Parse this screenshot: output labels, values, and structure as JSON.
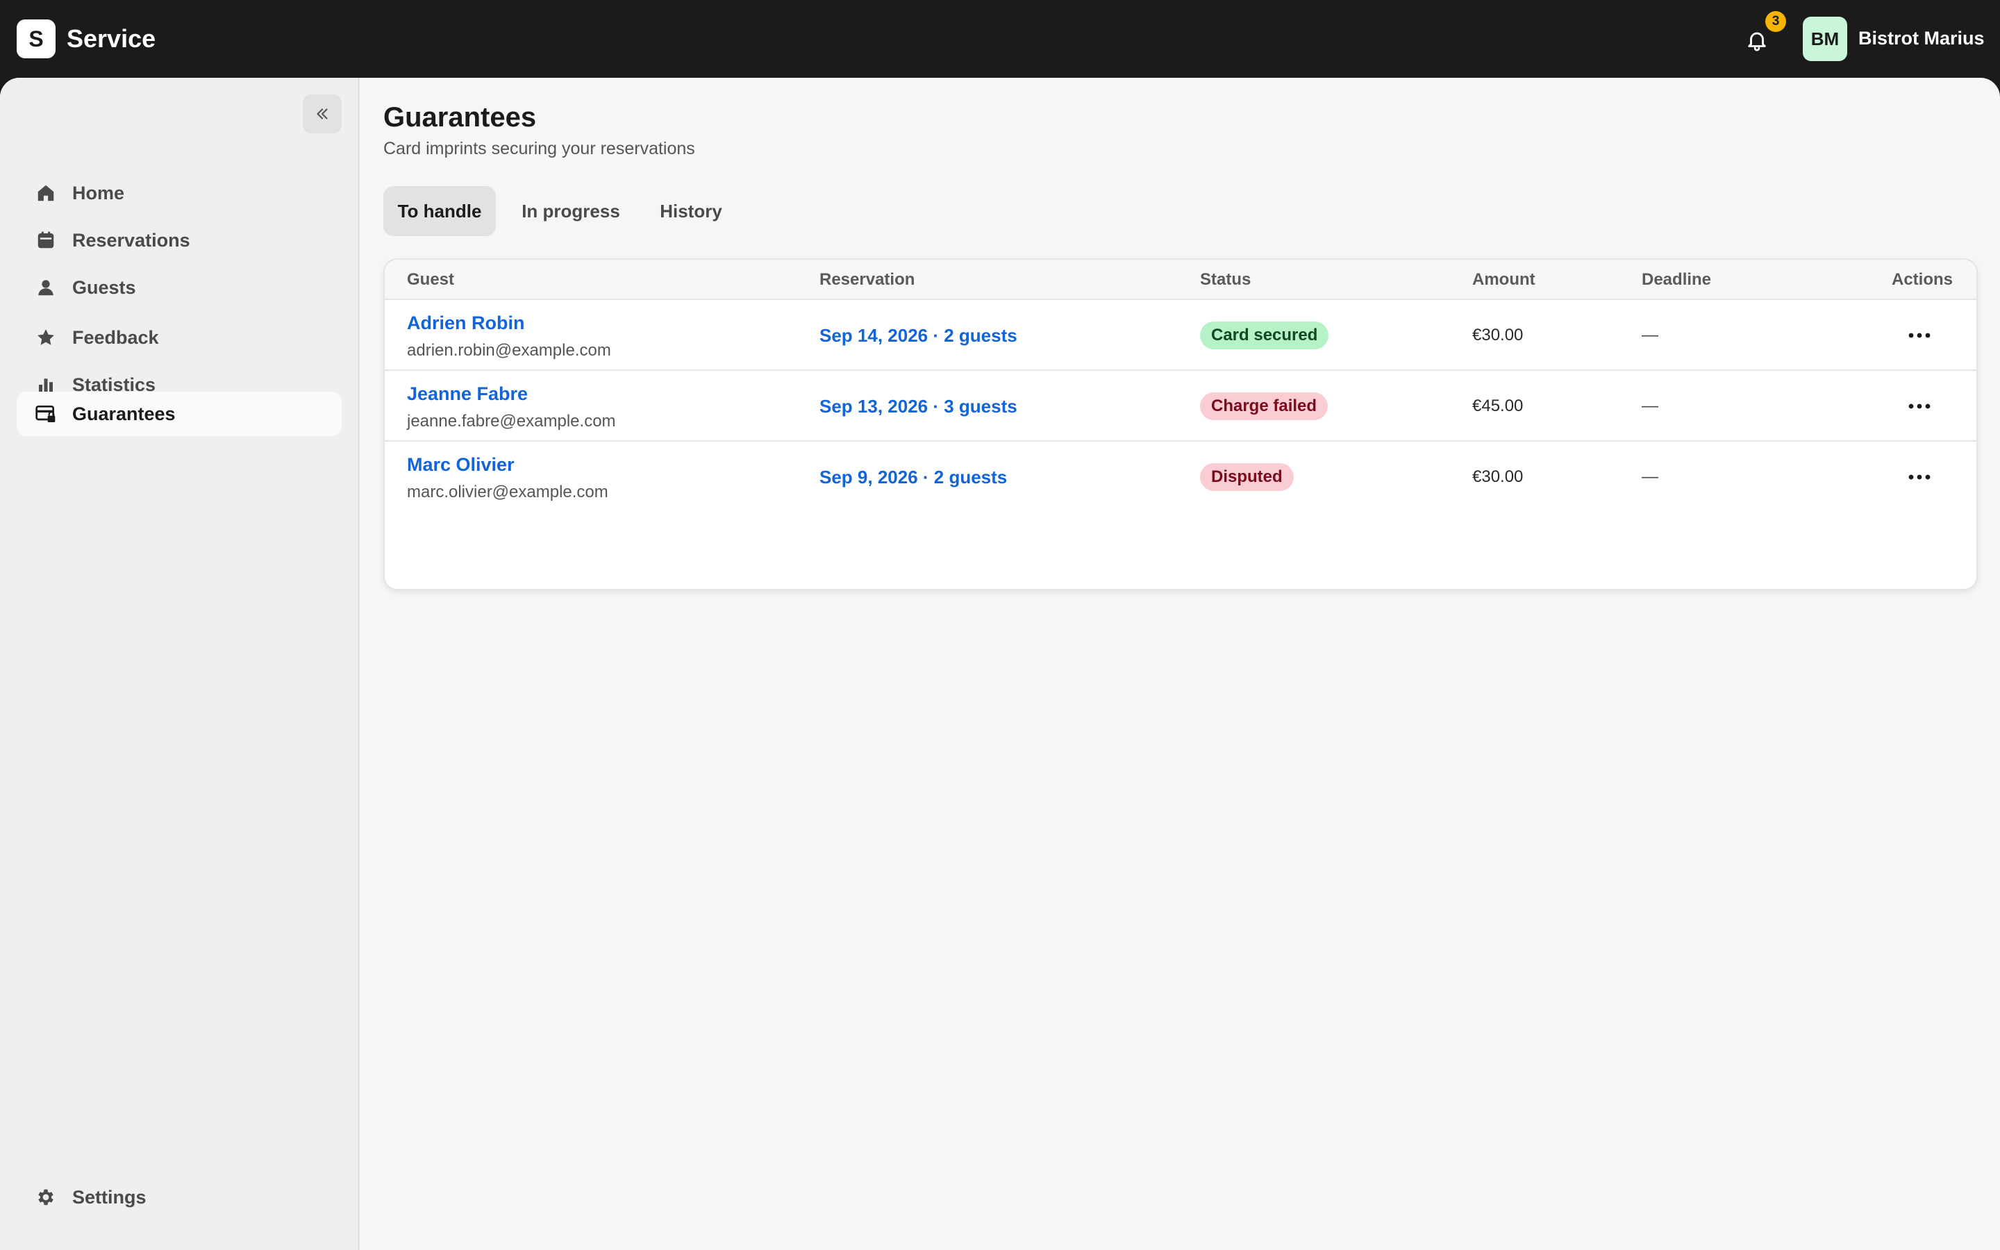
{
  "app": {
    "logo_letter": "S",
    "name": "Service"
  },
  "header": {
    "notifications_count": "3",
    "avatar_initials": "BM",
    "user_name": "Bistrot Marius"
  },
  "sidebar": {
    "items": [
      {
        "label": "Home",
        "icon": "home-icon"
      },
      {
        "label": "Reservations",
        "icon": "calendar-icon"
      },
      {
        "label": "Guests",
        "icon": "person-icon"
      },
      {
        "label": "Feedback",
        "icon": "star-icon"
      },
      {
        "label": "Statistics",
        "icon": "bar-chart-icon"
      },
      {
        "label": "Guarantees",
        "icon": "card-lock-icon",
        "active": true
      }
    ],
    "settings_label": "Settings"
  },
  "page": {
    "title": "Guarantees",
    "subtitle": "Card imprints securing your reservations"
  },
  "tabs": [
    {
      "label": "To handle",
      "active": true
    },
    {
      "label": "In progress"
    },
    {
      "label": "History"
    }
  ],
  "table": {
    "columns": [
      "Guest",
      "Reservation",
      "Status",
      "Amount",
      "Deadline",
      "Actions"
    ],
    "rows": [
      {
        "guest_name": "Adrien Robin",
        "guest_email": "adrien.robin@example.com",
        "reservation": "Sep 14, 2026 · 2 guests",
        "status": "Card secured",
        "status_kind": "success",
        "amount": "€30.00",
        "deadline": "—"
      },
      {
        "guest_name": "Jeanne Fabre",
        "guest_email": "jeanne.fabre@example.com",
        "reservation": "Sep 13, 2026 · 3 guests",
        "status": "Charge failed",
        "status_kind": "error",
        "amount": "€45.00",
        "deadline": "—"
      },
      {
        "guest_name": "Marc Olivier",
        "guest_email": "marc.olivier@example.com",
        "reservation": "Sep 9, 2026 · 2 guests",
        "status": "Disputed",
        "status_kind": "error",
        "amount": "€30.00",
        "deadline": "—"
      }
    ]
  },
  "colors": {
    "topbar": "#1b1b1b",
    "link": "#1264d8",
    "badge": "#f5b400",
    "status_success_bg": "#b6f2c8",
    "status_error_bg": "#f9cdd3"
  }
}
